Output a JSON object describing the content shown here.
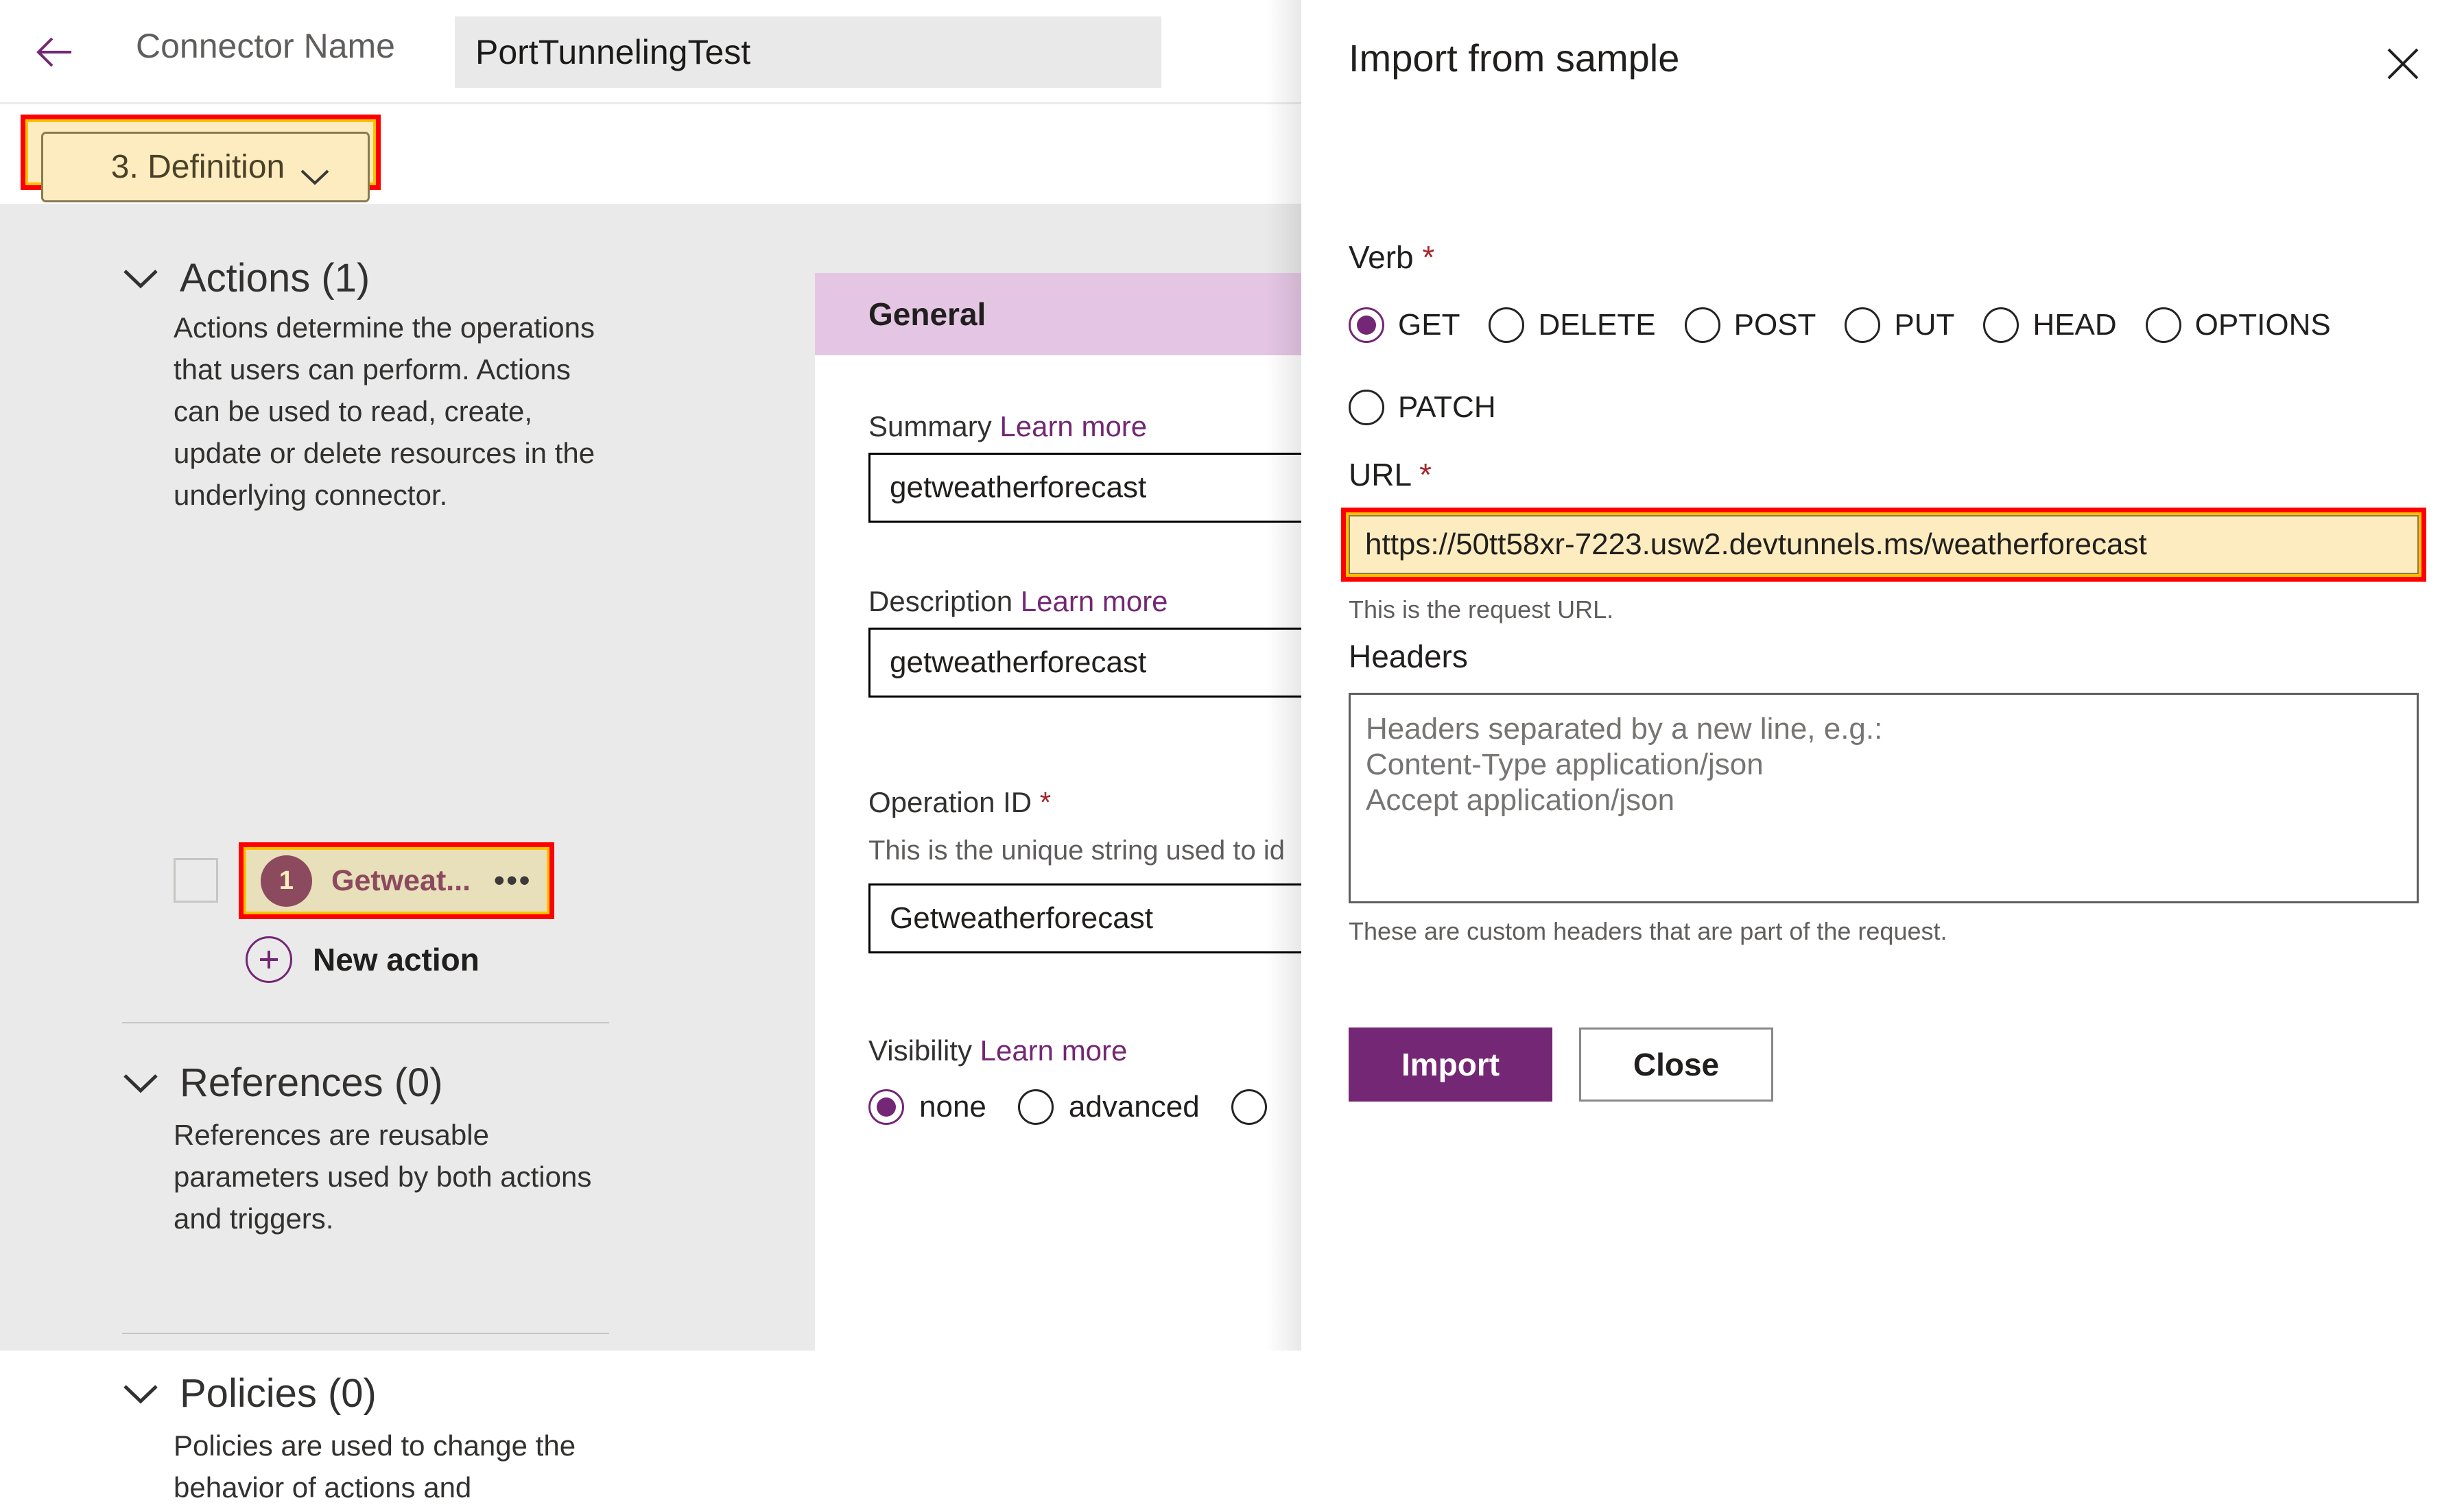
{
  "topbar": {
    "back_icon": "back-arrow-icon",
    "connector_name_label": "Connector Name",
    "connector_name_value": "PortTunnelingTest"
  },
  "tabstrip": {
    "definition_tab_label": "3. Definition",
    "chevron_icon": "chevron-down-icon"
  },
  "left_panel": {
    "sections": [
      {
        "title": "Actions (1)",
        "description": "Actions determine the operations that users can perform. Actions can be used to read, create, update or delete resources in the underlying connector."
      },
      {
        "title": "References (0)",
        "description": "References are reusable parameters used by both actions and triggers."
      },
      {
        "title": "Policies (0)",
        "description": "Policies are used to change the behavior of actions and"
      }
    ],
    "action_item": {
      "badge": "1",
      "label": "Getweat...",
      "ellipsis": "•••"
    },
    "new_action_label": "New action",
    "new_action_icon": "plus-circle-icon"
  },
  "middle_panel": {
    "section_header": "General",
    "learn_more": "Learn more",
    "required_marker": "*",
    "summary": {
      "label": "Summary",
      "value": "getweatherforecast"
    },
    "description": {
      "label": "Description",
      "value": "getweatherforecast"
    },
    "operation_id": {
      "label": "Operation ID",
      "hint": "This is the unique string used to id",
      "value": "Getweatherforecast"
    },
    "visibility": {
      "label": "Visibility",
      "options": [
        {
          "label": "none",
          "selected": true
        },
        {
          "label": "advanced",
          "selected": false
        },
        {
          "label": "",
          "selected": false
        }
      ]
    }
  },
  "dialog": {
    "title": "Import from sample",
    "close_icon": "close-icon",
    "verb": {
      "label": "Verb",
      "required_marker": "*",
      "options_row1": [
        {
          "label": "GET",
          "selected": true
        },
        {
          "label": "DELETE",
          "selected": false
        },
        {
          "label": "POST",
          "selected": false
        },
        {
          "label": "PUT",
          "selected": false
        },
        {
          "label": "HEAD",
          "selected": false
        },
        {
          "label": "OPTIONS",
          "selected": false
        }
      ],
      "options_row2": [
        {
          "label": "PATCH",
          "selected": false
        }
      ]
    },
    "url": {
      "label": "URL",
      "required_marker": "*",
      "value": "https://50tt58xr-7223.usw2.devtunnels.ms/weatherforecast",
      "hint": "This is the request URL."
    },
    "headers": {
      "label": "Headers",
      "placeholder": "Headers separated by a new line, e.g.:\nContent-Type application/json\nAccept application/json",
      "value": "",
      "hint": "These are custom headers that are part of the request."
    },
    "import_button": "Import",
    "close_button": "Close"
  },
  "colors": {
    "accent_purple": "#742774",
    "highlight_red": "#ff0000",
    "highlight_yellow": "#ffc000",
    "highlight_fill": "#fdecbf",
    "section_header_bg": "#e4c6e4",
    "badge_maroon": "#8c4a5e",
    "required_red": "#a4262c"
  }
}
